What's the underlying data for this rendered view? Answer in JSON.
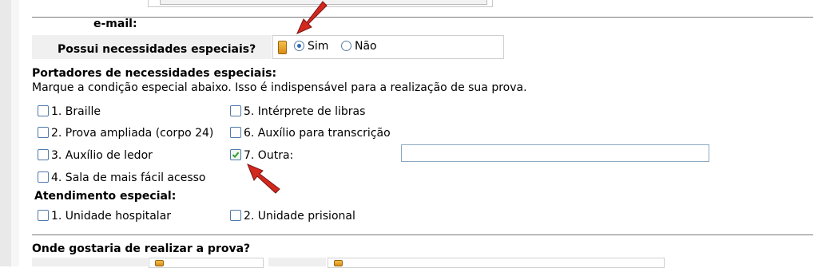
{
  "email": {
    "label": "e-mail:"
  },
  "special_needs": {
    "question": "Possui necessidades especiais?",
    "options": [
      {
        "label": "Sim",
        "selected": true
      },
      {
        "label": "Não",
        "selected": false
      }
    ]
  },
  "carriers": {
    "title": "Portadores de necessidades especiais:",
    "instruction": "Marque a condição especial abaixo. Isso é indispensável para a realização de sua prova.",
    "conditions": [
      {
        "label": "1. Braille",
        "checked": false
      },
      {
        "label": "2. Prova ampliada (corpo 24)",
        "checked": false
      },
      {
        "label": "3. Auxílio de ledor",
        "checked": false
      },
      {
        "label": "4. Sala de mais fácil acesso",
        "checked": false
      },
      {
        "label": "5. Intérprete de libras",
        "checked": false
      },
      {
        "label": "6. Auxílio para transcrição",
        "checked": false
      },
      {
        "label": "7. Outra:",
        "checked": true
      }
    ],
    "other_value": ""
  },
  "special_service": {
    "title": "Atendimento especial:",
    "options": [
      {
        "label": "1. Unidade hospitalar",
        "checked": false
      },
      {
        "label": "2. Unidade prisional",
        "checked": false
      }
    ]
  },
  "location": {
    "title": "Onde gostaria de realizar a prova?"
  },
  "colors": {
    "annotation_arrow": "#d2281e",
    "checkbox_border": "#4f79a8",
    "check_mark": "#2f9a2f"
  }
}
